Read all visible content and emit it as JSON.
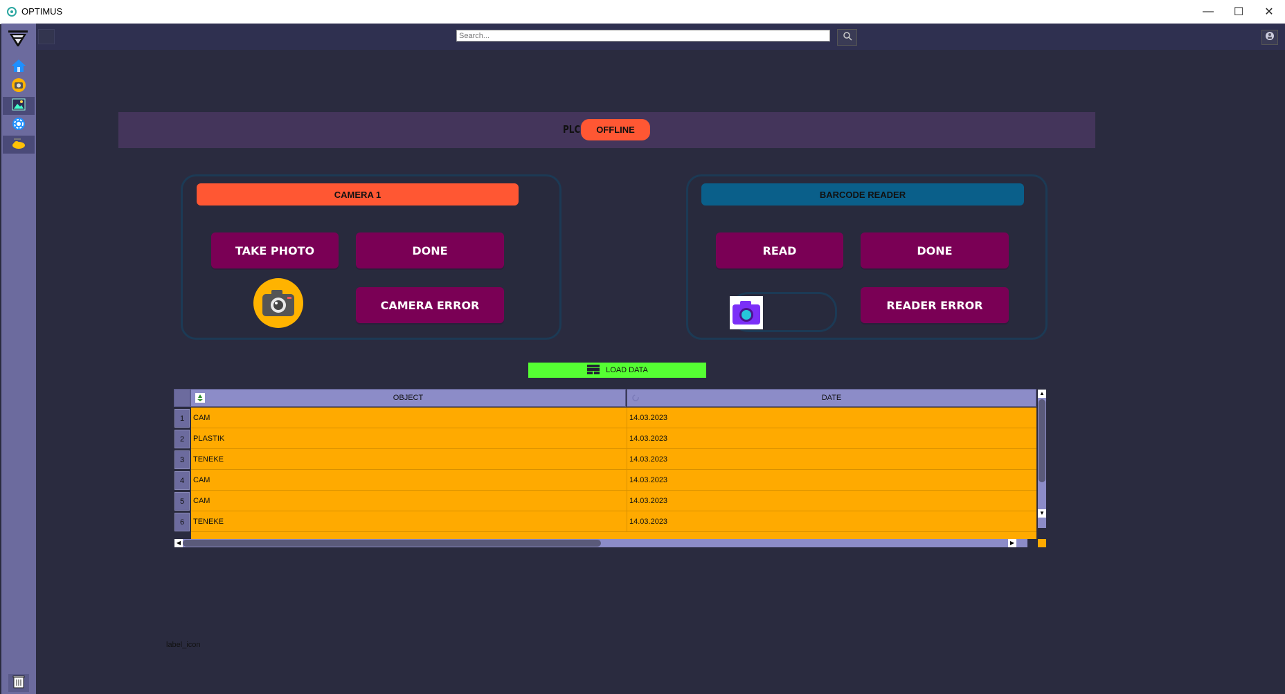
{
  "window": {
    "title": "OPTIMUS",
    "minimize_glyph": "—",
    "maximize_glyph": "☐",
    "close_glyph": "✕"
  },
  "sidebar": {
    "items": [
      {
        "name": "home",
        "icon": "home-icon"
      },
      {
        "name": "camera",
        "icon": "camera-icon"
      },
      {
        "name": "gallery",
        "icon": "image-icon"
      },
      {
        "name": "settings",
        "icon": "gear-icon"
      },
      {
        "name": "cloud",
        "icon": "cloud-icon"
      }
    ],
    "bottom_icon": "trash-icon"
  },
  "toolbar": {
    "search_placeholder": "Search..."
  },
  "plc": {
    "label": "PLC",
    "status": "OFFLINE",
    "status_color": "#ff5733"
  },
  "camera_panel": {
    "header": "CAMERA 1",
    "header_color": "#ff5733",
    "take_photo": "TAKE PHOTO",
    "done": "DONE",
    "error": "CAMERA ERROR"
  },
  "barcode_panel": {
    "header": "BARCODE READER",
    "header_color": "#0a5f8a",
    "read": "READ",
    "done": "DONE",
    "error": "READER ERROR"
  },
  "load_data": {
    "label": "LOAD DATA",
    "color": "#55ff33"
  },
  "table": {
    "columns": [
      "OBJECT",
      "DATE"
    ],
    "rows": [
      {
        "num": "1",
        "object": "CAM",
        "date": "14.03.2023"
      },
      {
        "num": "2",
        "object": "PLASTIK",
        "date": "14.03.2023"
      },
      {
        "num": "3",
        "object": "TENEKE",
        "date": "14.03.2023"
      },
      {
        "num": "4",
        "object": "CAM",
        "date": "14.03.2023"
      },
      {
        "num": "5",
        "object": "CAM",
        "date": "14.03.2023"
      },
      {
        "num": "6",
        "object": "TENEKE",
        "date": "14.03.2023"
      }
    ],
    "row_color": "#ffaa00"
  },
  "footer": {
    "label_icon": "label_icon"
  }
}
